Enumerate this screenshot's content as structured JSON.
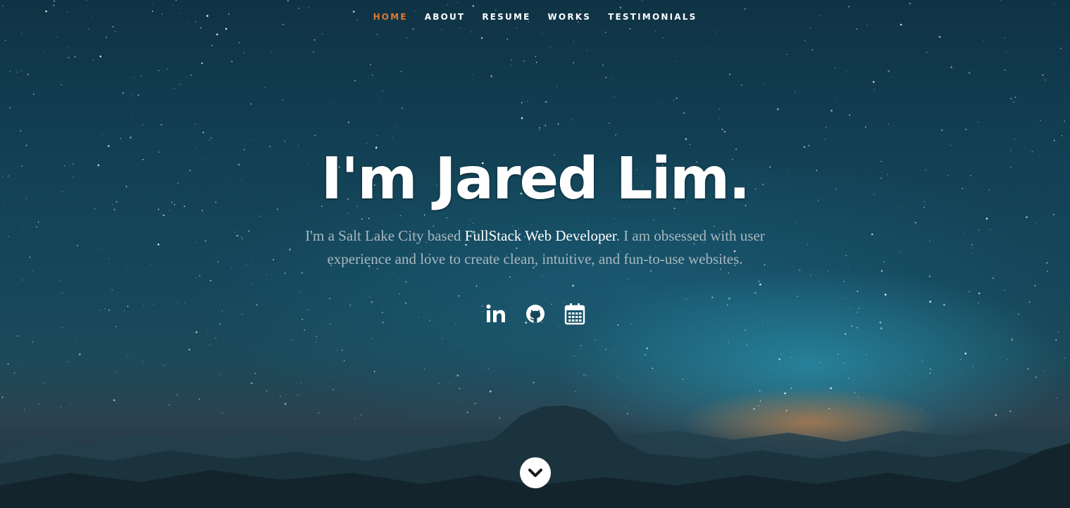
{
  "nav": {
    "items": [
      {
        "label": "HOME",
        "active": true
      },
      {
        "label": "ABOUT",
        "active": false
      },
      {
        "label": "RESUME",
        "active": false
      },
      {
        "label": "WORKS",
        "active": false
      },
      {
        "label": "TESTIMONIALS",
        "active": false
      }
    ]
  },
  "banner": {
    "headline": "I'm Jared Lim.",
    "intro_before": "I'm a Salt Lake City based ",
    "intro_highlight": "FullStack Web Developer",
    "intro_after": ". I am obsessed with user experience and love to create clean, intuitive, and fun-to-use websites."
  },
  "social": {
    "icons": [
      "linkedin-icon",
      "github-icon",
      "calendar-icon"
    ]
  },
  "scroll_down": {
    "icon": "chevron-down-icon"
  },
  "colors": {
    "accent": "#e07a2e",
    "text": "#ffffff",
    "intro_text": "#a9b8bf"
  }
}
